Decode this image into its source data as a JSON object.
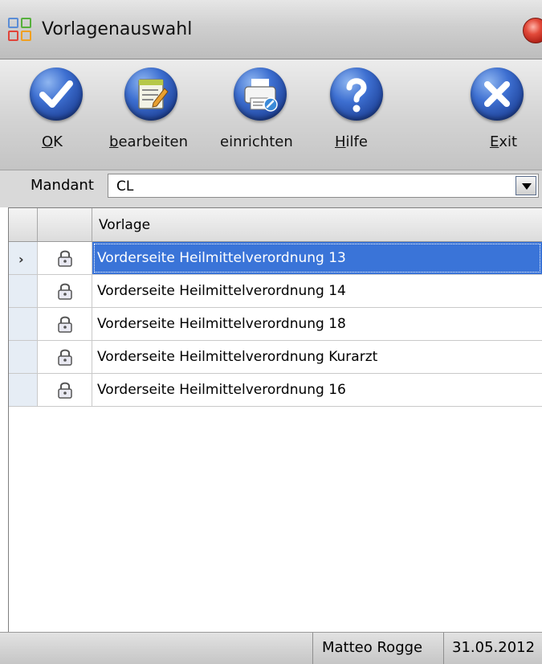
{
  "window": {
    "title": "Vorlagenauswahl"
  },
  "toolbar": {
    "buttons": [
      {
        "name": "ok",
        "label_accel": "O",
        "label_rest": "K",
        "icon": "checkmark-icon"
      },
      {
        "name": "bearbeiten",
        "label_accel": "b",
        "label_rest": "earbeiten",
        "icon": "edit-document-icon"
      },
      {
        "name": "einrichten",
        "label_accel": "",
        "label_rest": "einrichten",
        "icon": "printer-icon"
      },
      {
        "name": "hilfe",
        "label_accel": "H",
        "label_rest": "ilfe",
        "icon": "question-icon"
      },
      {
        "name": "exit",
        "label_accel": "E",
        "label_rest": "xit",
        "icon": "close-icon"
      }
    ]
  },
  "mandant": {
    "label": "Mandant",
    "value": "CL"
  },
  "grid": {
    "column_header": "Vorlage",
    "selected_index": 0,
    "rows": [
      {
        "name": "Vorderseite Heilmittelverordnung 13"
      },
      {
        "name": "Vorderseite Heilmittelverordnung 14"
      },
      {
        "name": "Vorderseite Heilmittelverordnung 18"
      },
      {
        "name": "Vorderseite Heilmittelverordnung Kurarzt"
      },
      {
        "name": "Vorderseite Heilmittelverordnung 16"
      }
    ]
  },
  "status": {
    "user": "Matteo Rogge",
    "date": "31.05.2012"
  },
  "colors": {
    "selection": "#3a74d8",
    "button_blue": "#3d6fd1"
  }
}
